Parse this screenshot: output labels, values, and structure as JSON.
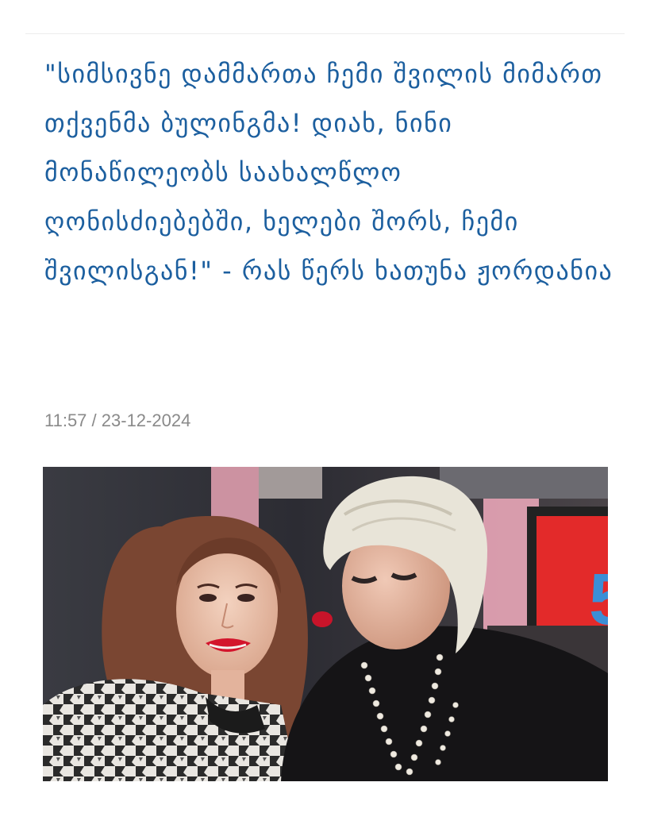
{
  "article": {
    "title": "\"სიმსივნე დამმართა ჩემი შვილის მიმართ თქვენმა ბულინგმა! დიახ, ნინი მონაწილეობს საახალწლო ღონისძიებებში, ხელები შორს, ჩემი შვილისგან!\" - რას წერს ხათუნა ჟორდანია",
    "time": "11:57",
    "date": "23-12-2024",
    "separator": " / ",
    "photo": {
      "screen_digit": "5",
      "colors": {
        "studio_red": "#e32a2a",
        "studio_pink": "#e8a3b4",
        "background_dark": "#2a2a2e",
        "hair_blonde": "#e8e4d8",
        "hair_brown": "#7a4632",
        "digit_blue": "#3b8fd6"
      }
    }
  }
}
